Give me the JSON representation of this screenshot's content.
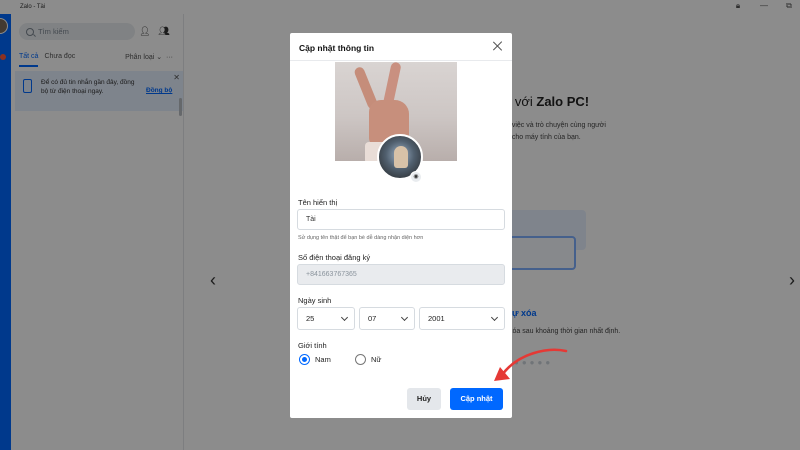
{
  "window": {
    "title": "Zalo - Tài"
  },
  "sidebar": {
    "search_placeholder": "Tìm kiếm",
    "tabs": [
      {
        "label": "Tất cả",
        "active": true
      },
      {
        "label": "Chưa đọc",
        "active": false
      }
    ],
    "classify_label": "Phân loại",
    "sync_banner": {
      "text": "Để có đủ tin nhắn gần đây, đồng bộ từ điện thoại ngay.",
      "link": "Đồng bộ"
    }
  },
  "main": {
    "welcome_suffix": "n với ",
    "welcome_brand": "Zalo PC!",
    "welcome_sub": "n việc và trò chuyện cùng người\nà cho máy tính của bạn.",
    "slide_heading": "tự xóa",
    "slide_desc": "xóa sau khoảng thời gian nhất định."
  },
  "modal": {
    "title": "Cập nhật thông tin",
    "display_name_label": "Tên hiển thị",
    "display_name_value": "Tài",
    "display_name_hint": "Sử dụng tên thật để bạn bè dễ dàng nhận diện hơn",
    "phone_label": "Số điện thoại đăng ký",
    "phone_value": "+841663767365",
    "dob_label": "Ngày sinh",
    "dob_day": "25",
    "dob_month": "07",
    "dob_year": "2001",
    "gender_label": "Giới tính",
    "gender_options": [
      {
        "label": "Nam",
        "checked": true
      },
      {
        "label": "Nữ",
        "checked": false
      }
    ],
    "cancel_label": "Hủy",
    "update_label": "Cập nhật"
  },
  "colors": {
    "accent": "#0068ff",
    "annotation": "#e53935"
  }
}
